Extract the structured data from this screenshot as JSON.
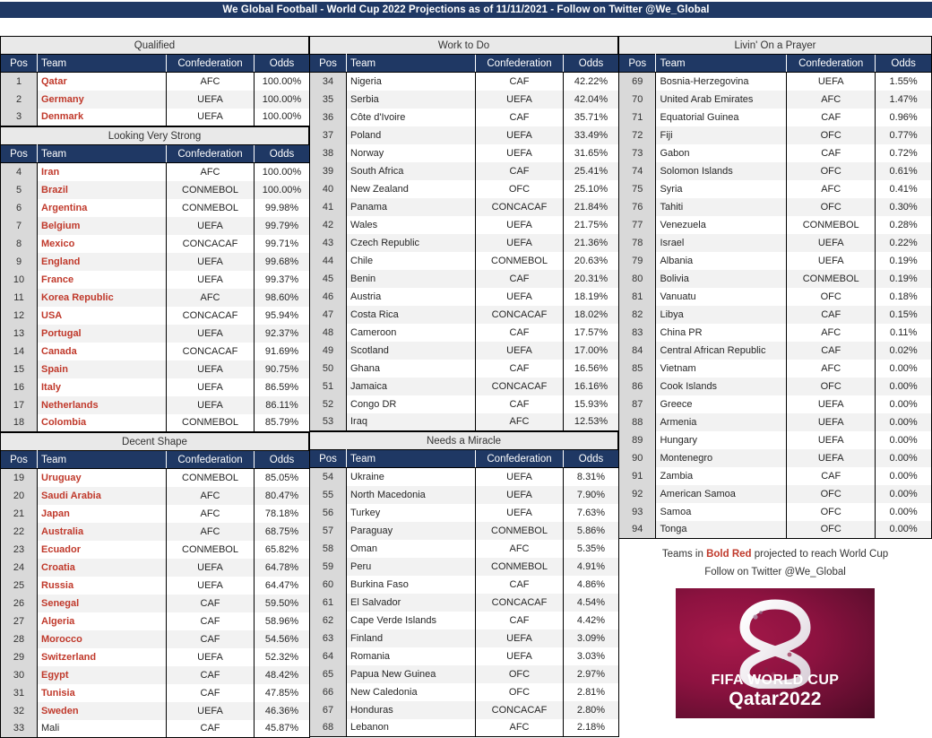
{
  "title": "We Global Football - World Cup 2022 Projections as of 11/11/2021 - Follow on Twitter @We_Global",
  "columns": {
    "pos": "Pos",
    "team": "Team",
    "confederation": "Confederation",
    "odds": "Odds"
  },
  "colors": {
    "header_navy": "#1f3864",
    "odds_header_red": "#8b2222",
    "qualify_red": "#c0392b",
    "band_gray": "#e9e9e9",
    "pos_cell_gray": "#d9d9d9",
    "row_alt_gray": "#f2f2f2"
  },
  "sections": [
    {
      "id": "qualified",
      "name": "Qualified",
      "column": "left",
      "rows": [
        {
          "pos": "1",
          "team": "Qatar",
          "conf": "AFC",
          "odds": "100.00%",
          "qualify": true
        },
        {
          "pos": "2",
          "team": "Germany",
          "conf": "UEFA",
          "odds": "100.00%",
          "qualify": true
        },
        {
          "pos": "3",
          "team": "Denmark",
          "conf": "UEFA",
          "odds": "100.00%",
          "qualify": true
        }
      ]
    },
    {
      "id": "looking-very-strong",
      "name": "Looking Very Strong",
      "column": "left",
      "rows": [
        {
          "pos": "4",
          "team": "Iran",
          "conf": "AFC",
          "odds": "100.00%",
          "qualify": true
        },
        {
          "pos": "5",
          "team": "Brazil",
          "conf": "CONMEBOL",
          "odds": "100.00%",
          "qualify": true
        },
        {
          "pos": "6",
          "team": "Argentina",
          "conf": "CONMEBOL",
          "odds": "99.98%",
          "qualify": true
        },
        {
          "pos": "7",
          "team": "Belgium",
          "conf": "UEFA",
          "odds": "99.79%",
          "qualify": true
        },
        {
          "pos": "8",
          "team": "Mexico",
          "conf": "CONCACAF",
          "odds": "99.71%",
          "qualify": true
        },
        {
          "pos": "9",
          "team": "England",
          "conf": "UEFA",
          "odds": "99.68%",
          "qualify": true
        },
        {
          "pos": "10",
          "team": "France",
          "conf": "UEFA",
          "odds": "99.37%",
          "qualify": true
        },
        {
          "pos": "11",
          "team": "Korea Republic",
          "conf": "AFC",
          "odds": "98.60%",
          "qualify": true
        },
        {
          "pos": "12",
          "team": "USA",
          "conf": "CONCACAF",
          "odds": "95.94%",
          "qualify": true
        },
        {
          "pos": "13",
          "team": "Portugal",
          "conf": "UEFA",
          "odds": "92.37%",
          "qualify": true
        },
        {
          "pos": "14",
          "team": "Canada",
          "conf": "CONCACAF",
          "odds": "91.69%",
          "qualify": true
        },
        {
          "pos": "15",
          "team": "Spain",
          "conf": "UEFA",
          "odds": "90.75%",
          "qualify": true
        },
        {
          "pos": "16",
          "team": "Italy",
          "conf": "UEFA",
          "odds": "86.59%",
          "qualify": true
        },
        {
          "pos": "17",
          "team": "Netherlands",
          "conf": "UEFA",
          "odds": "86.11%",
          "qualify": true
        },
        {
          "pos": "18",
          "team": "Colombia",
          "conf": "CONMEBOL",
          "odds": "85.79%",
          "qualify": true
        }
      ]
    },
    {
      "id": "decent-shape",
      "name": "Decent Shape",
      "column": "left",
      "rows": [
        {
          "pos": "19",
          "team": "Uruguay",
          "conf": "CONMEBOL",
          "odds": "85.05%",
          "qualify": true
        },
        {
          "pos": "20",
          "team": "Saudi Arabia",
          "conf": "AFC",
          "odds": "80.47%",
          "qualify": true
        },
        {
          "pos": "21",
          "team": "Japan",
          "conf": "AFC",
          "odds": "78.18%",
          "qualify": true
        },
        {
          "pos": "22",
          "team": "Australia",
          "conf": "AFC",
          "odds": "68.75%",
          "qualify": true
        },
        {
          "pos": "23",
          "team": "Ecuador",
          "conf": "CONMEBOL",
          "odds": "65.82%",
          "qualify": true
        },
        {
          "pos": "24",
          "team": "Croatia",
          "conf": "UEFA",
          "odds": "64.78%",
          "qualify": true
        },
        {
          "pos": "25",
          "team": "Russia",
          "conf": "UEFA",
          "odds": "64.47%",
          "qualify": true
        },
        {
          "pos": "26",
          "team": "Senegal",
          "conf": "CAF",
          "odds": "59.50%",
          "qualify": true
        },
        {
          "pos": "27",
          "team": "Algeria",
          "conf": "CAF",
          "odds": "58.96%",
          "qualify": true
        },
        {
          "pos": "28",
          "team": "Morocco",
          "conf": "CAF",
          "odds": "54.56%",
          "qualify": true
        },
        {
          "pos": "29",
          "team": "Switzerland",
          "conf": "UEFA",
          "odds": "52.32%",
          "qualify": true
        },
        {
          "pos": "30",
          "team": "Egypt",
          "conf": "CAF",
          "odds": "48.42%",
          "qualify": true
        },
        {
          "pos": "31",
          "team": "Tunisia",
          "conf": "CAF",
          "odds": "47.85%",
          "qualify": true
        },
        {
          "pos": "32",
          "team": "Sweden",
          "conf": "UEFA",
          "odds": "46.36%",
          "qualify": true
        },
        {
          "pos": "33",
          "team": "Mali",
          "conf": "CAF",
          "odds": "45.87%",
          "qualify": false
        }
      ]
    },
    {
      "id": "work-to-do",
      "name": "Work to Do",
      "column": "mid",
      "rows": [
        {
          "pos": "34",
          "team": "Nigeria",
          "conf": "CAF",
          "odds": "42.22%",
          "qualify": false
        },
        {
          "pos": "35",
          "team": "Serbia",
          "conf": "UEFA",
          "odds": "42.04%",
          "qualify": false
        },
        {
          "pos": "36",
          "team": "Côte d'Ivoire",
          "conf": "CAF",
          "odds": "35.71%",
          "qualify": false
        },
        {
          "pos": "37",
          "team": "Poland",
          "conf": "UEFA",
          "odds": "33.49%",
          "qualify": false
        },
        {
          "pos": "38",
          "team": "Norway",
          "conf": "UEFA",
          "odds": "31.65%",
          "qualify": false
        },
        {
          "pos": "39",
          "team": "South Africa",
          "conf": "CAF",
          "odds": "25.41%",
          "qualify": false
        },
        {
          "pos": "40",
          "team": "New Zealand",
          "conf": "OFC",
          "odds": "25.10%",
          "qualify": false
        },
        {
          "pos": "41",
          "team": "Panama",
          "conf": "CONCACAF",
          "odds": "21.84%",
          "qualify": false
        },
        {
          "pos": "42",
          "team": "Wales",
          "conf": "UEFA",
          "odds": "21.75%",
          "qualify": false
        },
        {
          "pos": "43",
          "team": "Czech Republic",
          "conf": "UEFA",
          "odds": "21.36%",
          "qualify": false
        },
        {
          "pos": "44",
          "team": "Chile",
          "conf": "CONMEBOL",
          "odds": "20.63%",
          "qualify": false
        },
        {
          "pos": "45",
          "team": "Benin",
          "conf": "CAF",
          "odds": "20.31%",
          "qualify": false
        },
        {
          "pos": "46",
          "team": "Austria",
          "conf": "UEFA",
          "odds": "18.19%",
          "qualify": false
        },
        {
          "pos": "47",
          "team": "Costa Rica",
          "conf": "CONCACAF",
          "odds": "18.02%",
          "qualify": false
        },
        {
          "pos": "48",
          "team": "Cameroon",
          "conf": "CAF",
          "odds": "17.57%",
          "qualify": false
        },
        {
          "pos": "49",
          "team": "Scotland",
          "conf": "UEFA",
          "odds": "17.00%",
          "qualify": false
        },
        {
          "pos": "50",
          "team": "Ghana",
          "conf": "CAF",
          "odds": "16.56%",
          "qualify": false
        },
        {
          "pos": "51",
          "team": "Jamaica",
          "conf": "CONCACAF",
          "odds": "16.16%",
          "qualify": false
        },
        {
          "pos": "52",
          "team": "Congo DR",
          "conf": "CAF",
          "odds": "15.93%",
          "qualify": false
        },
        {
          "pos": "53",
          "team": "Iraq",
          "conf": "AFC",
          "odds": "12.53%",
          "qualify": false
        }
      ]
    },
    {
      "id": "needs-a-miracle",
      "name": "Needs a Miracle",
      "column": "mid",
      "rows": [
        {
          "pos": "54",
          "team": "Ukraine",
          "conf": "UEFA",
          "odds": "8.31%",
          "qualify": false
        },
        {
          "pos": "55",
          "team": "North Macedonia",
          "conf": "UEFA",
          "odds": "7.90%",
          "qualify": false
        },
        {
          "pos": "56",
          "team": "Turkey",
          "conf": "UEFA",
          "odds": "7.63%",
          "qualify": false
        },
        {
          "pos": "57",
          "team": "Paraguay",
          "conf": "CONMEBOL",
          "odds": "5.86%",
          "qualify": false
        },
        {
          "pos": "58",
          "team": "Oman",
          "conf": "AFC",
          "odds": "5.35%",
          "qualify": false
        },
        {
          "pos": "59",
          "team": "Peru",
          "conf": "CONMEBOL",
          "odds": "4.91%",
          "qualify": false
        },
        {
          "pos": "60",
          "team": "Burkina Faso",
          "conf": "CAF",
          "odds": "4.86%",
          "qualify": false
        },
        {
          "pos": "61",
          "team": "El Salvador",
          "conf": "CONCACAF",
          "odds": "4.54%",
          "qualify": false
        },
        {
          "pos": "62",
          "team": "Cape Verde Islands",
          "conf": "CAF",
          "odds": "4.42%",
          "qualify": false
        },
        {
          "pos": "63",
          "team": "Finland",
          "conf": "UEFA",
          "odds": "3.09%",
          "qualify": false
        },
        {
          "pos": "64",
          "team": "Romania",
          "conf": "UEFA",
          "odds": "3.03%",
          "qualify": false
        },
        {
          "pos": "65",
          "team": "Papua New Guinea",
          "conf": "OFC",
          "odds": "2.97%",
          "qualify": false
        },
        {
          "pos": "66",
          "team": "New Caledonia",
          "conf": "OFC",
          "odds": "2.81%",
          "qualify": false
        },
        {
          "pos": "67",
          "team": "Honduras",
          "conf": "CONCACAF",
          "odds": "2.80%",
          "qualify": false
        },
        {
          "pos": "68",
          "team": "Lebanon",
          "conf": "AFC",
          "odds": "2.18%",
          "qualify": false
        }
      ]
    },
    {
      "id": "livin-on-a-prayer",
      "name": "Livin' On a Prayer",
      "column": "right",
      "rows": [
        {
          "pos": "69",
          "team": "Bosnia-Herzegovina",
          "conf": "UEFA",
          "odds": "1.55%",
          "qualify": false
        },
        {
          "pos": "70",
          "team": "United Arab Emirates",
          "conf": "AFC",
          "odds": "1.47%",
          "qualify": false
        },
        {
          "pos": "71",
          "team": "Equatorial Guinea",
          "conf": "CAF",
          "odds": "0.96%",
          "qualify": false
        },
        {
          "pos": "72",
          "team": "Fiji",
          "conf": "OFC",
          "odds": "0.77%",
          "qualify": false
        },
        {
          "pos": "73",
          "team": "Gabon",
          "conf": "CAF",
          "odds": "0.72%",
          "qualify": false
        },
        {
          "pos": "74",
          "team": "Solomon Islands",
          "conf": "OFC",
          "odds": "0.61%",
          "qualify": false
        },
        {
          "pos": "75",
          "team": "Syria",
          "conf": "AFC",
          "odds": "0.41%",
          "qualify": false
        },
        {
          "pos": "76",
          "team": "Tahiti",
          "conf": "OFC",
          "odds": "0.30%",
          "qualify": false
        },
        {
          "pos": "77",
          "team": "Venezuela",
          "conf": "CONMEBOL",
          "odds": "0.28%",
          "qualify": false
        },
        {
          "pos": "78",
          "team": "Israel",
          "conf": "UEFA",
          "odds": "0.22%",
          "qualify": false
        },
        {
          "pos": "79",
          "team": "Albania",
          "conf": "UEFA",
          "odds": "0.19%",
          "qualify": false
        },
        {
          "pos": "80",
          "team": "Bolivia",
          "conf": "CONMEBOL",
          "odds": "0.19%",
          "qualify": false
        },
        {
          "pos": "81",
          "team": "Vanuatu",
          "conf": "OFC",
          "odds": "0.18%",
          "qualify": false
        },
        {
          "pos": "82",
          "team": "Libya",
          "conf": "CAF",
          "odds": "0.15%",
          "qualify": false
        },
        {
          "pos": "83",
          "team": "China PR",
          "conf": "AFC",
          "odds": "0.11%",
          "qualify": false
        },
        {
          "pos": "84",
          "team": "Central African Republic",
          "conf": "CAF",
          "odds": "0.02%",
          "qualify": false
        },
        {
          "pos": "85",
          "team": "Vietnam",
          "conf": "AFC",
          "odds": "0.00%",
          "qualify": false
        },
        {
          "pos": "86",
          "team": "Cook Islands",
          "conf": "OFC",
          "odds": "0.00%",
          "qualify": false
        },
        {
          "pos": "87",
          "team": "Greece",
          "conf": "UEFA",
          "odds": "0.00%",
          "qualify": false
        },
        {
          "pos": "88",
          "team": "Armenia",
          "conf": "UEFA",
          "odds": "0.00%",
          "qualify": false
        },
        {
          "pos": "89",
          "team": "Hungary",
          "conf": "UEFA",
          "odds": "0.00%",
          "qualify": false
        },
        {
          "pos": "90",
          "team": "Montenegro",
          "conf": "UEFA",
          "odds": "0.00%",
          "qualify": false
        },
        {
          "pos": "91",
          "team": "Zambia",
          "conf": "CAF",
          "odds": "0.00%",
          "qualify": false
        },
        {
          "pos": "92",
          "team": "American Samoa",
          "conf": "OFC",
          "odds": "0.00%",
          "qualify": false
        },
        {
          "pos": "93",
          "team": "Samoa",
          "conf": "OFC",
          "odds": "0.00%",
          "qualify": false
        },
        {
          "pos": "94",
          "team": "Tonga",
          "conf": "OFC",
          "odds": "0.00%",
          "qualify": false
        }
      ]
    }
  ],
  "footer": {
    "legend_prefix": "Teams in ",
    "legend_highlight": "Bold Red",
    "legend_suffix": " projected to reach World Cup",
    "twitter_line": "Follow on Twitter @We_Global"
  },
  "logo": {
    "name": "qatar-2022-world-cup-logo",
    "line1": "FIFA WORLD CUP",
    "line2": "Qatar2022"
  }
}
